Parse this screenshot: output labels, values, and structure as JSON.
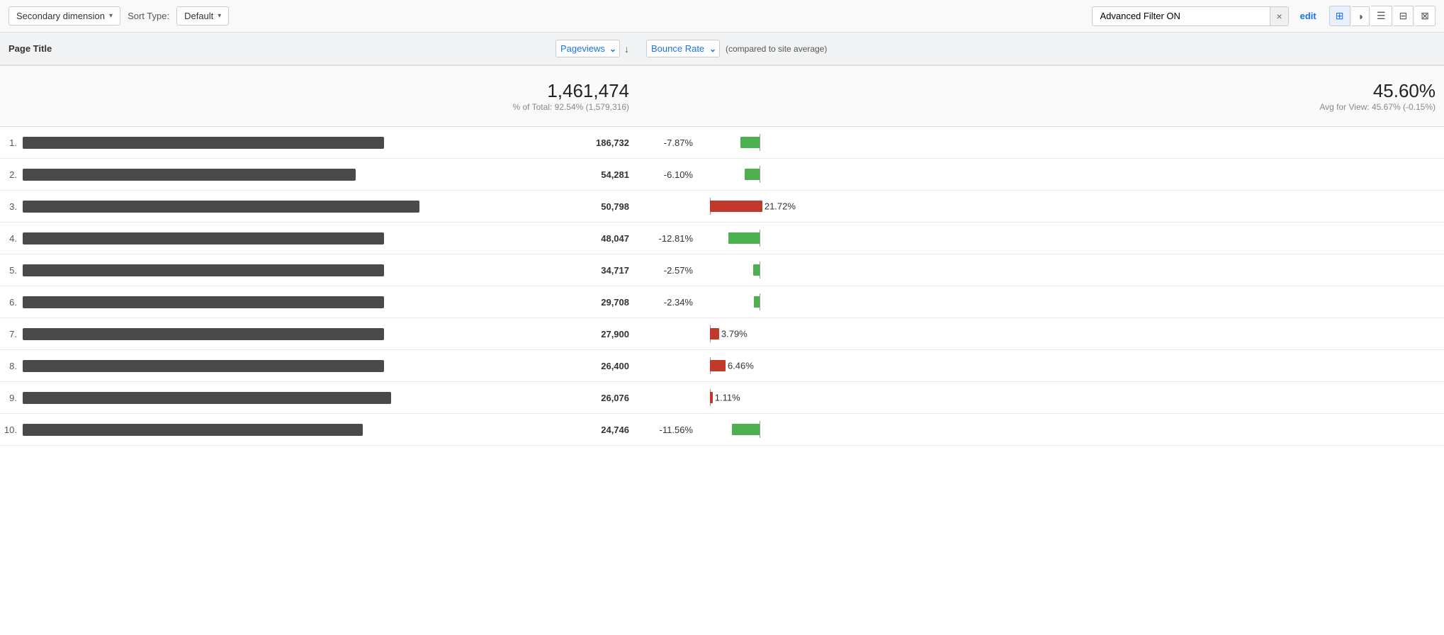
{
  "toolbar": {
    "secondary_dimension_label": "Secondary dimension",
    "sort_type_label": "Sort Type:",
    "sort_default": "Default",
    "filter_value": "Advanced Filter ON",
    "clear_btn": "×",
    "edit_label": "edit",
    "view_icons": [
      "⊞",
      "◑",
      "☰",
      "⊟",
      "⊠"
    ]
  },
  "table": {
    "col_page_title": "Page Title",
    "col_pageviews": "Pageviews",
    "col_bounce": "Bounce Rate",
    "col_compared": "(compared to site average)",
    "sort_icon": "↓",
    "totals": {
      "pageviews": "1,461,474",
      "pageviews_pct": "% of Total: 92.54% (1,579,316)",
      "bounce_rate": "45.60%",
      "bounce_avg": "Avg for View: 45.67% (-0.15%)"
    },
    "rows": [
      {
        "num": "1.",
        "title_width": 510,
        "pageviews": "186,732",
        "bounce_pct": "-7.87%",
        "bounce_val": -7.87,
        "type": "negative"
      },
      {
        "num": "2.",
        "title_width": 470,
        "pageviews": "54,281",
        "bounce_pct": "-6.10%",
        "bounce_val": -6.1,
        "type": "negative"
      },
      {
        "num": "3.",
        "title_width": 560,
        "pageviews": "50,798",
        "bounce_pct": "21.72%",
        "bounce_val": 21.72,
        "type": "positive"
      },
      {
        "num": "4.",
        "title_width": 510,
        "pageviews": "48,047",
        "bounce_pct": "-12.81%",
        "bounce_val": -12.81,
        "type": "negative"
      },
      {
        "num": "5.",
        "title_width": 510,
        "pageviews": "34,717",
        "bounce_pct": "-2.57%",
        "bounce_val": -2.57,
        "type": "negative"
      },
      {
        "num": "6.",
        "title_width": 510,
        "pageviews": "29,708",
        "bounce_pct": "-2.34%",
        "bounce_val": -2.34,
        "type": "negative"
      },
      {
        "num": "7.",
        "title_width": 510,
        "pageviews": "27,900",
        "bounce_pct": "3.79%",
        "bounce_val": 3.79,
        "type": "positive"
      },
      {
        "num": "8.",
        "title_width": 510,
        "pageviews": "26,400",
        "bounce_pct": "6.46%",
        "bounce_val": 6.46,
        "type": "positive"
      },
      {
        "num": "9.",
        "title_width": 520,
        "pageviews": "26,076",
        "bounce_pct": "1.11%",
        "bounce_val": 1.11,
        "type": "positive"
      },
      {
        "num": "10.",
        "title_width": 480,
        "pageviews": "24,746",
        "bounce_pct": "-11.56%",
        "bounce_val": -11.56,
        "type": "negative"
      }
    ]
  }
}
